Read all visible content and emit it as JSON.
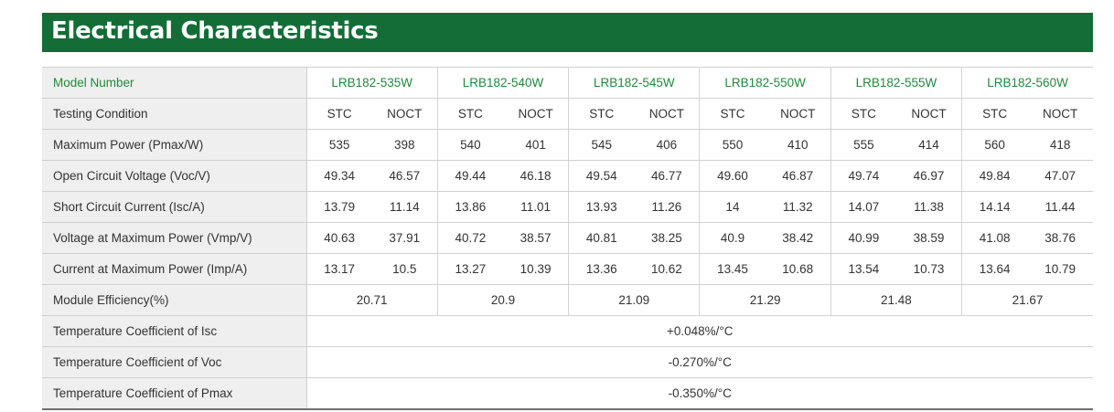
{
  "title": "Electrical Characteristics",
  "header": {
    "label": "Model Number",
    "models": [
      "LRB182-535W",
      "LRB182-540W",
      "LRB182-545W",
      "LRB182-550W",
      "LRB182-555W",
      "LRB182-560W"
    ]
  },
  "conditions": {
    "label": "Testing Condition",
    "values": [
      "STC",
      "NOCT",
      "STC",
      "NOCT",
      "STC",
      "NOCT",
      "STC",
      "NOCT",
      "STC",
      "NOCT",
      "STC",
      "NOCT"
    ]
  },
  "rows": [
    {
      "label": "Maximum Power (Pmax/W)",
      "values": [
        "535",
        "398",
        "540",
        "401",
        "545",
        "406",
        "550",
        "410",
        "555",
        "414",
        "560",
        "418"
      ]
    },
    {
      "label": "Open Circuit Voltage (Voc/V)",
      "values": [
        "49.34",
        "46.57",
        "49.44",
        "46.18",
        "49.54",
        "46.77",
        "49.60",
        "46.87",
        "49.74",
        "46.97",
        "49.84",
        "47.07"
      ]
    },
    {
      "label": "Short Circuit Current (Isc/A)",
      "values": [
        "13.79",
        "11.14",
        "13.86",
        "11.01",
        "13.93",
        "11.26",
        "14",
        "11.32",
        "14.07",
        "11.38",
        "14.14",
        "11.44"
      ]
    },
    {
      "label": "Voltage at Maximum Power (Vmp/V)",
      "values": [
        "40.63",
        "37.91",
        "40.72",
        "38.57",
        "40.81",
        "38.25",
        "40.9",
        "38.42",
        "40.99",
        "38.59",
        "41.08",
        "38.76"
      ]
    },
    {
      "label": "Current at Maximum Power (Imp/A)",
      "values": [
        "13.17",
        "10.5",
        "13.27",
        "10.39",
        "13.36",
        "10.62",
        "13.45",
        "10.68",
        "13.54",
        "10.73",
        "13.64",
        "10.79"
      ]
    }
  ],
  "efficiency": {
    "label": "Module Efficiency(%)",
    "values": [
      "20.71",
      "20.9",
      "21.09",
      "21.29",
      "21.48",
      "21.67"
    ]
  },
  "coefficients": [
    {
      "label": "Temperature Coefficient of Isc",
      "value": "+0.048%/°C"
    },
    {
      "label": "Temperature Coefficient of Voc",
      "value": "-0.270%/°C"
    },
    {
      "label": "Temperature Coefficient of Pmax",
      "value": "-0.350%/°C"
    }
  ],
  "colors": {
    "title_bg": "#126d36",
    "model_text": "#1f8a3b",
    "label_bg": "#efefef"
  }
}
